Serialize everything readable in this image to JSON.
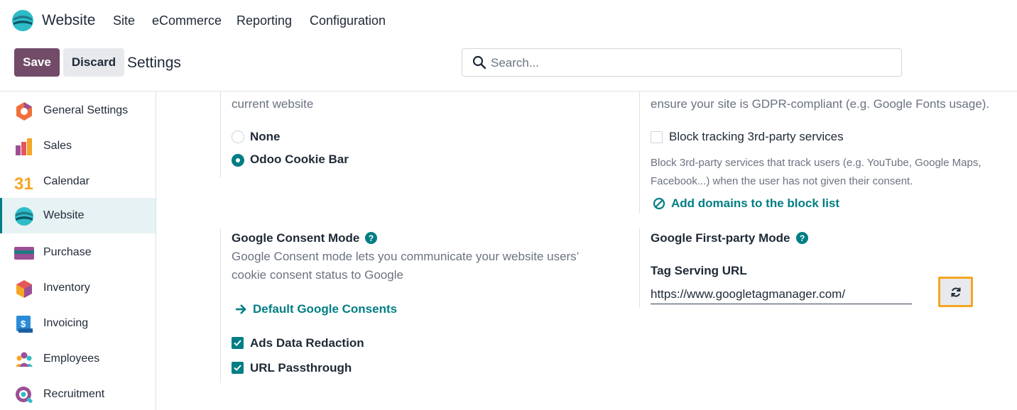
{
  "nav": {
    "app_name": "Website",
    "menu": [
      "Site",
      "eCommerce",
      "Reporting",
      "Configuration"
    ]
  },
  "control": {
    "save_label": "Save",
    "discard_label": "Discard",
    "title": "Settings",
    "search_placeholder": "Search..."
  },
  "sidebar": {
    "items": [
      {
        "label": "General Settings",
        "icon": "general-settings-icon"
      },
      {
        "label": "Sales",
        "icon": "sales-icon"
      },
      {
        "label": "Calendar",
        "icon": "calendar-icon",
        "icon_text": "31"
      },
      {
        "label": "Website",
        "icon": "website-icon",
        "active": true
      },
      {
        "label": "Purchase",
        "icon": "purchase-icon"
      },
      {
        "label": "Inventory",
        "icon": "inventory-icon"
      },
      {
        "label": "Invoicing",
        "icon": "invoicing-icon"
      },
      {
        "label": "Employees",
        "icon": "employees-icon"
      },
      {
        "label": "Recruitment",
        "icon": "recruitment-icon"
      }
    ]
  },
  "cookies": {
    "desc_tail": "current website",
    "options": [
      {
        "label": "None",
        "selected": false
      },
      {
        "label": "Odoo Cookie Bar",
        "selected": true
      }
    ]
  },
  "tracking": {
    "desc_tail": "ensure your site is GDPR-compliant (e.g. Google Fonts usage).",
    "checkbox_label": "Block tracking 3rd-party services",
    "checkbox_checked": false,
    "help_line1": "Block 3rd-party services that track users (e.g. YouTube, Google Maps,",
    "help_line2": "Facebook...) when the user has not given their consent.",
    "link_label": "Add domains to the block list"
  },
  "consent_mode": {
    "title": "Google Consent Mode",
    "desc_line1": "Google Consent mode lets you communicate your website users’",
    "desc_line2": "cookie consent status to Google",
    "link_label": "Default Google Consents",
    "checks": [
      {
        "label": "Ads Data Redaction",
        "checked": true
      },
      {
        "label": "URL Passthrough",
        "checked": true
      }
    ]
  },
  "first_party": {
    "title": "Google First-party Mode",
    "field_label": "Tag Serving URL",
    "field_value": "https://www.googletagmanager.com/"
  },
  "colors": {
    "brand": "#714b67",
    "accent": "#017e84",
    "highlight": "#f5a623"
  }
}
